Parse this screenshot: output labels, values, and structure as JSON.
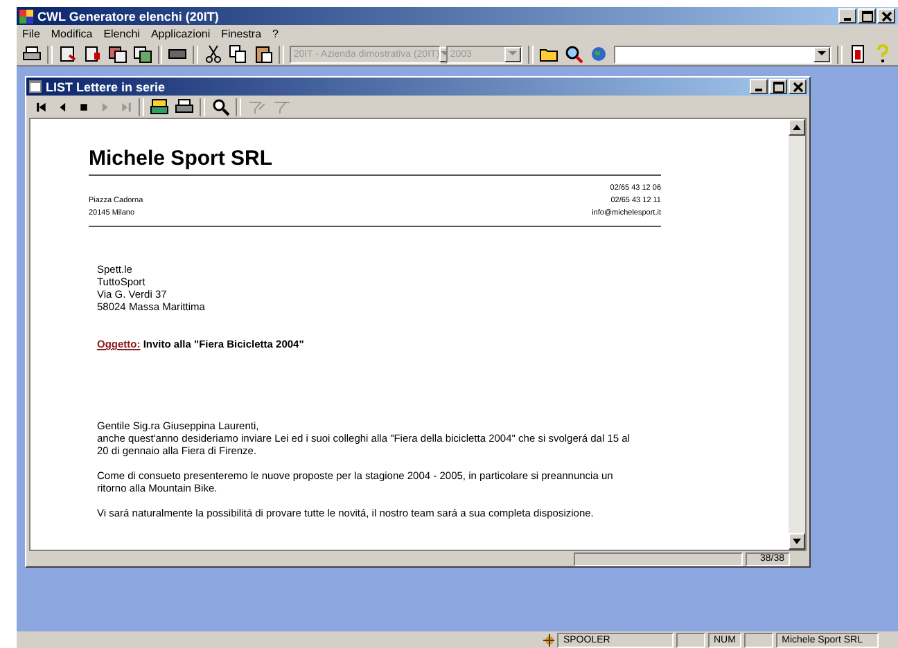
{
  "window": {
    "title": "CWL Generatore elenchi (20IT)"
  },
  "menu": [
    "File",
    "Modifica",
    "Elenchi",
    "Applicazioni",
    "Finestra",
    "?"
  ],
  "toolbar": {
    "company_select": {
      "value": "20IT - Azienda dimostrativa (20IT)",
      "disabled": true
    },
    "year_select": {
      "value": "2003",
      "disabled": true
    }
  },
  "child_window": {
    "title": "LIST Lettere in serie",
    "document": {
      "company_name": "Michele Sport SRL",
      "address_lines": [
        "Piazza Cadorna",
        "20145 Milano"
      ],
      "contact_lines": [
        "02/65 43 12 06",
        "02/65 43 12 11",
        "info@michelesport.it"
      ],
      "recipient_lines": [
        "Spett.le",
        "TuttoSport",
        "Via G. Verdi 37",
        "58024  Massa Marittima"
      ],
      "subject_label": "Oggetto:",
      "subject_text": "Invito alla \"Fiera Bicicletta 2004\"",
      "greeting": "Gentile Sig.ra Giuseppina Laurenti,",
      "paragraphs": [
        "anche quest'anno desideriamo inviare Lei ed i suoi colleghi alla \"Fiera della bicicletta 2004\" che si svolgerá dal 15 al 20 di gennaio alla Fiera di Firenze.",
        "Come di consueto presenteremo le nuove proposte per la stagione 2004 - 2005, in particolare si preannuncia un ritorno alla  Mountain Bike.",
        "Vi sará naturalmente la possibilitá di provare tutte le novitá, il nostro team sará a sua completa disposizione."
      ]
    },
    "page_counter": "38/38"
  },
  "status_bar": [
    "SPOOLER",
    "NUM",
    "Michele Sport SRL"
  ]
}
